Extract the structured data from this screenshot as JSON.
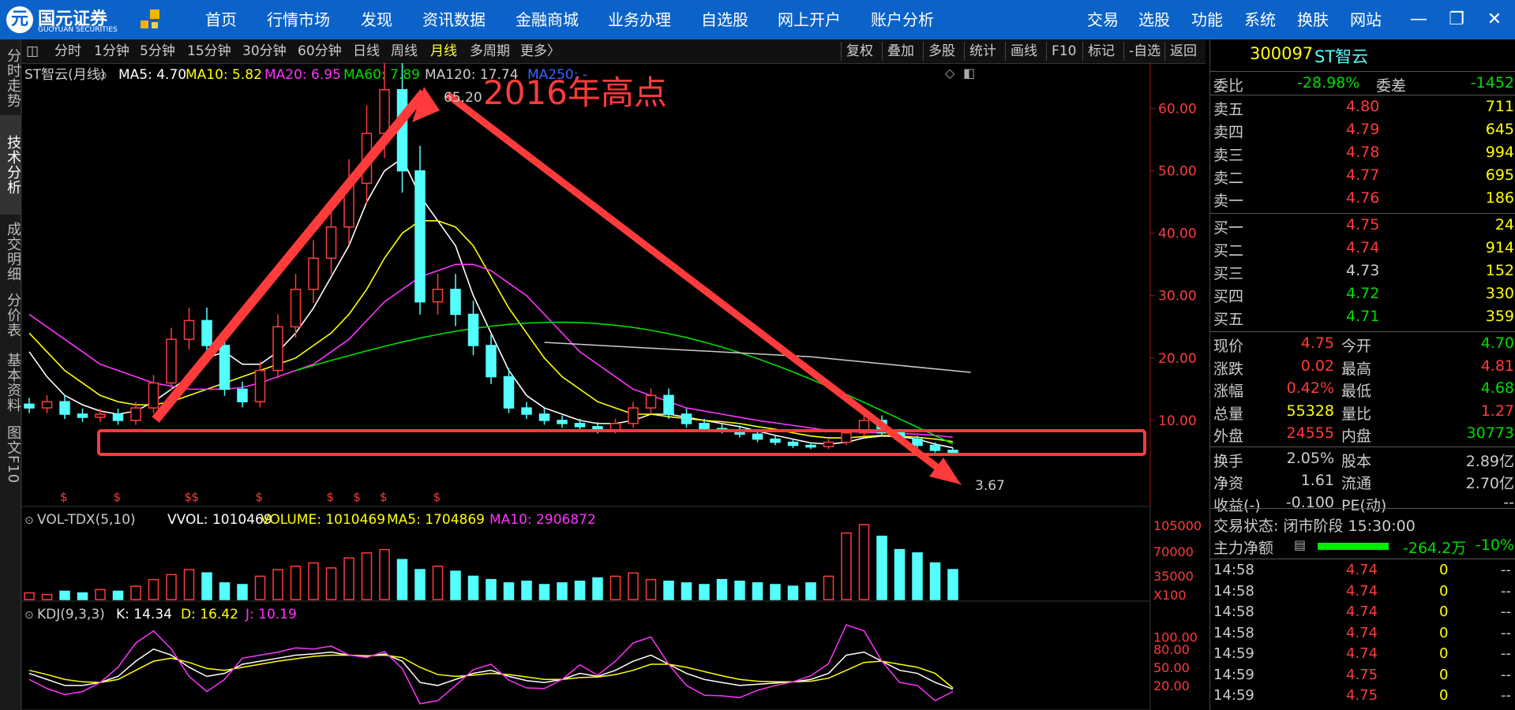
{
  "app": {
    "logo_text": "国元证券",
    "logo_sub": "GUOYUAN SECURITIES",
    "nav": [
      "首页",
      "行情市场",
      "发现",
      "资讯数据",
      "金融商城",
      "业务办理",
      "自选股",
      "网上开户",
      "账户分析"
    ],
    "right_nav": [
      "交易",
      "选股",
      "功能",
      "系统",
      "换肤",
      "网站"
    ],
    "window_buttons": [
      "minimize-icon",
      "restore-icon",
      "close-icon"
    ]
  },
  "left_tabs": [
    "分时走势",
    "技术分析",
    "成交明细",
    "分价表",
    "基本资料",
    "图文F10"
  ],
  "toolbar": {
    "periods": [
      "分时",
      "1分钟",
      "5分钟",
      "15分钟",
      "30分钟",
      "60分钟",
      "日线",
      "周线",
      "月线",
      "多周期",
      "更多〉"
    ],
    "selected": "月线",
    "right": [
      "复权",
      "叠加",
      "多股",
      "统计",
      "画线",
      "F10",
      "标记",
      "-自选",
      "返回"
    ]
  },
  "colors": {
    "up": "#ff3b3b",
    "down": "#54ffff",
    "ma5": "#ffffff",
    "ma10": "#ffff00",
    "ma20": "#ff33ff",
    "ma60": "#00dd00",
    "ma120": "#cccccc",
    "ma250": "#3366ff",
    "annot": "#ff3b3b"
  },
  "main_chart": {
    "title": "ST智云(月线)",
    "ma": [
      {
        "label": "MA5: 4.70",
        "color": "#ffffff"
      },
      {
        "label": "MA10: 5.82",
        "color": "#ffff00"
      },
      {
        "label": "MA20: 6.95",
        "color": "#ff33ff"
      },
      {
        "label": "MA60: 7.89",
        "color": "#00dd00"
      },
      {
        "label": "MA120: 17.74",
        "color": "#cccccc"
      },
      {
        "label": "MA250: -",
        "color": "#3366ff"
      }
    ],
    "high_label": "65.20",
    "low_label": "3.67",
    "annotation": "2016年高点",
    "y_ticks": [
      "60.00",
      "50.00",
      "40.00",
      "30.00",
      "20.00",
      "10.00"
    ]
  },
  "chart_data": [
    {
      "type": "candlestick",
      "title": "ST智云(月线)",
      "ylim": [
        0,
        66
      ],
      "y_ticks": [
        10,
        20,
        30,
        40,
        50,
        60
      ],
      "series": [
        {
          "name": "close",
          "values": [
            12,
            13,
            11,
            10.5,
            11,
            10,
            12,
            16,
            23,
            26,
            22,
            15,
            13,
            18,
            25,
            31,
            36,
            41,
            48,
            56,
            63,
            50,
            29,
            31,
            27,
            22,
            17,
            12,
            11,
            10,
            9.5,
            9,
            8.5,
            9.5,
            12,
            14,
            11,
            9.5,
            8.7,
            8.5,
            7.8,
            7,
            6.5,
            6,
            5.8,
            6.5,
            8,
            10,
            8,
            7,
            6,
            5.2,
            4.7
          ]
        },
        {
          "name": "MA5",
          "values": [
            21,
            17,
            14,
            12.5,
            11.5,
            11,
            11.5,
            13,
            15,
            17,
            20,
            21,
            19,
            19,
            21,
            24,
            28,
            33,
            38,
            45,
            50,
            52,
            46,
            42,
            38,
            30,
            24,
            18,
            14,
            12,
            11,
            10,
            9.5,
            9.5,
            10,
            11,
            11,
            10.5,
            10,
            9.5,
            9,
            8.3,
            7.6,
            7,
            6.4,
            6.2,
            6.5,
            7.2,
            7.5,
            7.4,
            7,
            6.2,
            5.6
          ]
        },
        {
          "name": "MA10",
          "values": [
            24,
            21,
            18,
            16,
            14,
            13,
            12.5,
            12.5,
            13,
            14,
            15,
            16,
            17,
            18,
            19,
            20,
            22,
            24,
            27,
            31,
            36,
            40,
            42,
            42,
            41,
            38,
            33,
            28,
            24,
            20,
            17,
            15,
            13,
            12,
            11,
            11,
            10.6,
            10.3,
            10,
            9.8,
            9.5,
            9,
            8.6,
            8,
            7.5,
            7.2,
            7.2,
            7.4,
            7.6,
            7.5,
            7.3,
            7,
            6.6
          ]
        },
        {
          "name": "MA20",
          "values": [
            27,
            25,
            23,
            21,
            19,
            18,
            17,
            16,
            15.5,
            15,
            15,
            15,
            15.3,
            16,
            17,
            18,
            19,
            21,
            23,
            26,
            29,
            31,
            33,
            34,
            35,
            35,
            34,
            32,
            30,
            27,
            24,
            21,
            19,
            17,
            15,
            14,
            13,
            12,
            11.5,
            11,
            10.5,
            10,
            9.6,
            9.2,
            8.8,
            8.4,
            8.2,
            8.1,
            8,
            7.9,
            7.8,
            7.6,
            7.3
          ]
        }
      ]
    },
    {
      "type": "bar",
      "title": "VOL-TDX(5,10)",
      "series_labels": [
        "VVOL: 1010469",
        "VOLUME: 1010469",
        "MA5: 1704869",
        "MA10: 2906872"
      ],
      "y_ticks": [
        "105000",
        "70000",
        "35000",
        "X100"
      ],
      "values": [
        4,
        3,
        5,
        4,
        6,
        5,
        8,
        12,
        15,
        18,
        16,
        10,
        9,
        14,
        18,
        20,
        22,
        19,
        25,
        28,
        30,
        24,
        18,
        20,
        17,
        14,
        12,
        10,
        11,
        9,
        10,
        11,
        13,
        14,
        16,
        12,
        11,
        10,
        9,
        12,
        11,
        10,
        9,
        8,
        10,
        14,
        40,
        45,
        38,
        30,
        28,
        22,
        18
      ]
    },
    {
      "type": "line",
      "title": "KDJ(9,3,3)",
      "series_labels": [
        "K: 14.34",
        "D: 16.42",
        "J: 10.19"
      ],
      "y_ticks": [
        "100.00",
        "80.00",
        "50.00",
        "20.00"
      ],
      "series": [
        {
          "name": "K",
          "values": [
            40,
            30,
            20,
            20,
            25,
            35,
            60,
            80,
            70,
            50,
            35,
            40,
            55,
            60,
            65,
            70,
            72,
            75,
            70,
            68,
            72,
            60,
            25,
            20,
            30,
            40,
            45,
            35,
            28,
            25,
            30,
            40,
            35,
            45,
            60,
            70,
            55,
            40,
            30,
            25,
            20,
            22,
            24,
            26,
            30,
            40,
            70,
            75,
            60,
            45,
            40,
            25,
            14
          ]
        },
        {
          "name": "D",
          "values": [
            45,
            38,
            30,
            26,
            25,
            30,
            45,
            60,
            65,
            58,
            48,
            45,
            50,
            55,
            60,
            64,
            68,
            70,
            70,
            69,
            70,
            66,
            50,
            38,
            35,
            37,
            40,
            38,
            34,
            30,
            30,
            33,
            34,
            38,
            45,
            55,
            55,
            50,
            43,
            36,
            30,
            27,
            26,
            26,
            27,
            32,
            45,
            58,
            60,
            55,
            50,
            40,
            16
          ]
        },
        {
          "name": "J",
          "values": [
            30,
            15,
            5,
            10,
            25,
            50,
            90,
            110,
            80,
            35,
            10,
            30,
            65,
            70,
            75,
            82,
            80,
            85,
            70,
            66,
            76,
            48,
            -10,
            -5,
            20,
            46,
            55,
            29,
            16,
            15,
            30,
            54,
            37,
            60,
            90,
            100,
            55,
            20,
            4,
            3,
            0,
            12,
            20,
            26,
            36,
            56,
            120,
            110,
            60,
            25,
            20,
            -5,
            10
          ]
        }
      ]
    }
  ],
  "vol_chart": {
    "title": "VOL-TDX(5,10)",
    "labels": [
      {
        "text": "VVOL: 1010469",
        "color": "#ffffff"
      },
      {
        "text": "VOLUME: 1010469",
        "color": "#ffff00"
      },
      {
        "text": "MA5: 1704869",
        "color": "#ffff00"
      },
      {
        "text": "MA10: 2906872",
        "color": "#ff33ff"
      }
    ],
    "y_ticks": [
      "105000",
      "70000",
      "35000",
      "X100"
    ]
  },
  "kdj_chart": {
    "title": "KDJ(9,3,3)",
    "labels": [
      {
        "text": "K: 14.34",
        "color": "#ffffff"
      },
      {
        "text": "D: 16.42",
        "color": "#ffff00"
      },
      {
        "text": "J: 10.19",
        "color": "#ff33ff"
      }
    ],
    "y_ticks": [
      "100.00",
      "80.00",
      "50.00",
      "20.00"
    ]
  },
  "quote": {
    "code": "300097",
    "name": "ST智云",
    "weibi_label": "委比",
    "weibi": "-28.98%",
    "weicha_label": "委差",
    "weicha": "-1452",
    "sell": [
      {
        "label": "卖五",
        "price": "4.80",
        "vol": "711"
      },
      {
        "label": "卖四",
        "price": "4.79",
        "vol": "645"
      },
      {
        "label": "卖三",
        "price": "4.78",
        "vol": "994"
      },
      {
        "label": "卖二",
        "price": "4.77",
        "vol": "695"
      },
      {
        "label": "卖一",
        "price": "4.76",
        "vol": "186"
      }
    ],
    "buy": [
      {
        "label": "买一",
        "price": "4.75",
        "vol": "24"
      },
      {
        "label": "买二",
        "price": "4.74",
        "vol": "914"
      },
      {
        "label": "买三",
        "price": "4.73",
        "vol": "152"
      },
      {
        "label": "买四",
        "price": "4.72",
        "vol": "330"
      },
      {
        "label": "买五",
        "price": "4.71",
        "vol": "359"
      }
    ],
    "stats": [
      {
        "l1": "现价",
        "v1": "4.75",
        "l2": "今开",
        "v2": "4.70",
        "c1": "#ff3b3b",
        "c2": "#00dd00"
      },
      {
        "l1": "涨跌",
        "v1": "0.02",
        "l2": "最高",
        "v2": "4.81",
        "c1": "#ff3b3b",
        "c2": "#ff3b3b"
      },
      {
        "l1": "涨幅",
        "v1": "0.42%",
        "l2": "最低",
        "v2": "4.68",
        "c1": "#ff3b3b",
        "c2": "#00dd00"
      },
      {
        "l1": "总量",
        "v1": "55328",
        "l2": "量比",
        "v2": "1.27",
        "c1": "#ffff00",
        "c2": "#ff3b3b"
      },
      {
        "l1": "外盘",
        "v1": "24555",
        "l2": "内盘",
        "v2": "30773",
        "c1": "#ff3b3b",
        "c2": "#00dd00"
      }
    ],
    "info": [
      {
        "l1": "换手",
        "v1": "2.05%",
        "l2": "股本",
        "v2": "2.89亿"
      },
      {
        "l1": "净资",
        "v1": "1.61",
        "l2": "流通",
        "v2": "2.70亿"
      },
      {
        "l1": "收益(-)",
        "v1": "-0.100",
        "l2": "PE(动)",
        "v2": "--"
      }
    ],
    "status": "交易状态: 闭市阶段 15:30:00",
    "main_flow_label": "主力净额",
    "main_flow_value": "-264.2万",
    "main_flow_pct": "-10%",
    "ticks": [
      {
        "time": "14:58",
        "price": "4.74",
        "vol": "0",
        "flag": "--"
      },
      {
        "time": "14:58",
        "price": "4.74",
        "vol": "0",
        "flag": "--"
      },
      {
        "time": "14:58",
        "price": "4.74",
        "vol": "0",
        "flag": "--"
      },
      {
        "time": "14:58",
        "price": "4.74",
        "vol": "0",
        "flag": "--"
      },
      {
        "time": "14:59",
        "price": "4.74",
        "vol": "0",
        "flag": "--"
      },
      {
        "time": "14:59",
        "price": "4.75",
        "vol": "0",
        "flag": "--"
      },
      {
        "time": "14:59",
        "price": "4.75",
        "vol": "0",
        "flag": "--"
      }
    ]
  }
}
